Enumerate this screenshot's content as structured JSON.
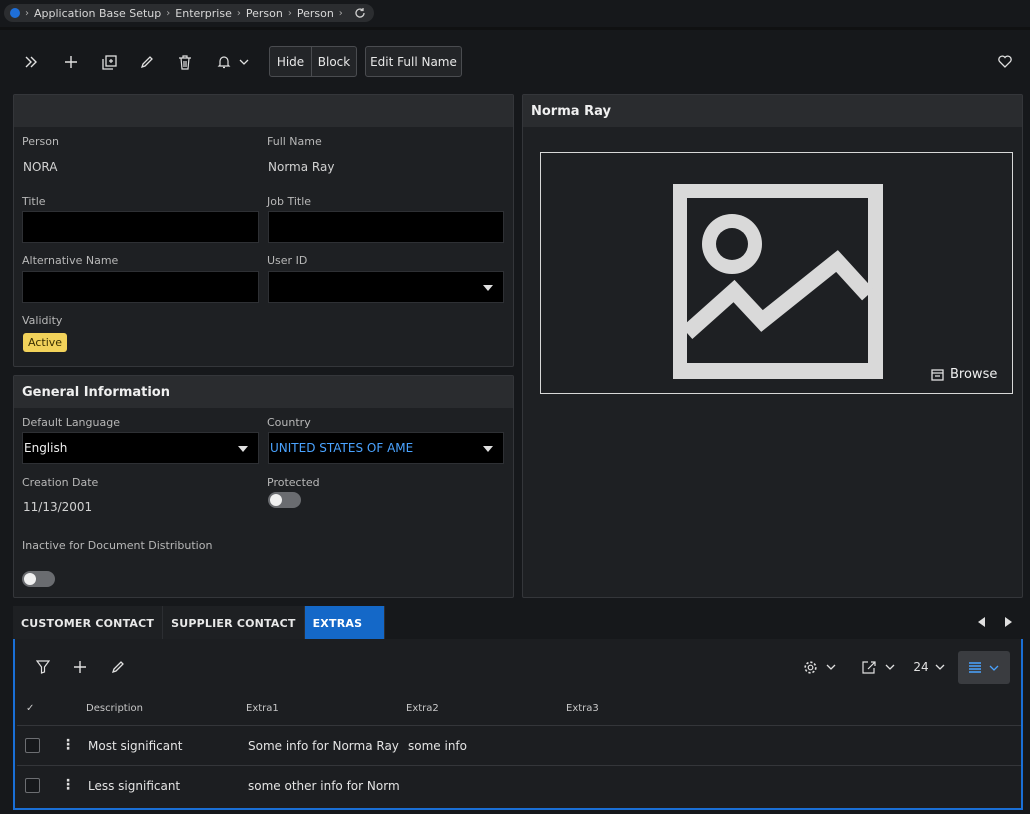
{
  "breadcrumb": [
    "Application Base Setup",
    "Enterprise",
    "Person",
    "Person"
  ],
  "toolbar": {
    "hide": "Hide",
    "block": "Block",
    "edit_full_name": "Edit Full Name"
  },
  "person_panel": {
    "person_label": "Person",
    "person_value": "NORA",
    "full_name_label": "Full Name",
    "full_name_value": "Norma Ray",
    "title_label": "Title",
    "title_value": "",
    "job_title_label": "Job Title",
    "job_title_value": "",
    "alt_name_label": "Alternative Name",
    "alt_name_value": "",
    "user_id_label": "User ID",
    "user_id_value": "",
    "validity_label": "Validity",
    "validity_value": "Active"
  },
  "general": {
    "title": "General Information",
    "default_language_label": "Default Language",
    "default_language_value": "English",
    "country_label": "Country",
    "country_value": "UNITED STATES OF AME",
    "creation_date_label": "Creation Date",
    "creation_date_value": "11/13/2001",
    "protected_label": "Protected",
    "inactive_label": "Inactive for Document Distribution"
  },
  "image_panel": {
    "title": "Norma Ray",
    "browse": "Browse"
  },
  "tabs": [
    {
      "label": "CUSTOMER CONTACT",
      "active": false
    },
    {
      "label": "SUPPLIER CONTACT",
      "active": false
    },
    {
      "label": "EXTRAS",
      "active": true
    }
  ],
  "grid": {
    "page_size": "24",
    "columns": [
      "Description",
      "Extra1",
      "Extra2",
      "Extra3"
    ],
    "rows": [
      {
        "description": "Most significant",
        "extra1": "Some info for Norma Ray",
        "extra2": "some info",
        "extra3": ""
      },
      {
        "description": "Less significant",
        "extra1": "some other info for Norm",
        "extra2": "",
        "extra3": ""
      }
    ]
  },
  "colors": {
    "accent": "#1468c8",
    "badge": "#f2d25a",
    "link": "#4aa3ff"
  }
}
